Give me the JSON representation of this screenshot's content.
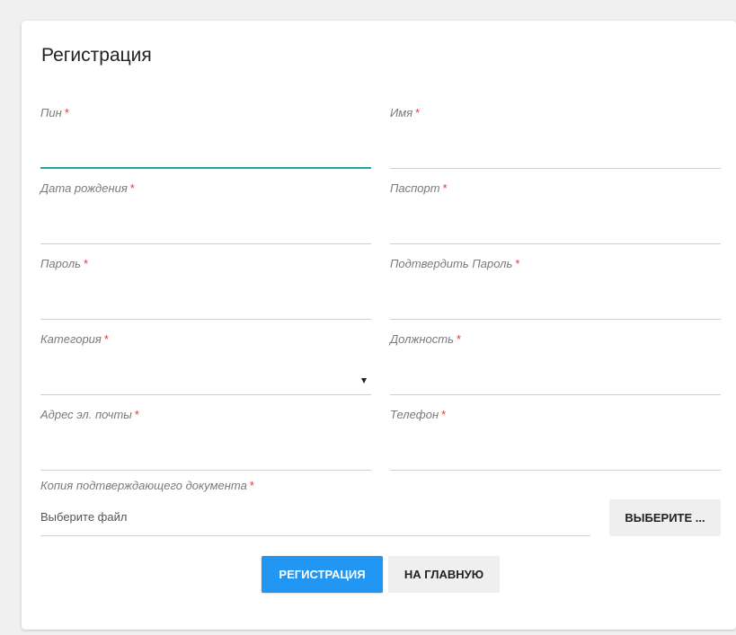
{
  "form": {
    "title": "Регистрация",
    "required_mark": "*",
    "fields": {
      "pin": {
        "label": "Пин",
        "value": ""
      },
      "name": {
        "label": "Имя",
        "value": ""
      },
      "birth_date": {
        "label": "Дата рождения",
        "value": ""
      },
      "passport": {
        "label": "Паспорт",
        "value": ""
      },
      "password": {
        "label": "Пароль",
        "value": ""
      },
      "confirm_password": {
        "label": "Подтвердить Пароль",
        "value": ""
      },
      "category": {
        "label": "Категория",
        "value": ""
      },
      "position": {
        "label": "Должность",
        "value": ""
      },
      "email": {
        "label": "Адрес эл. почты",
        "value": ""
      },
      "phone": {
        "label": "Телефон",
        "value": ""
      }
    },
    "file": {
      "label": "Копия подтверждающего документа",
      "placeholder": "Выберите файл",
      "button_label": "ВЫБЕРИТЕ ..."
    },
    "buttons": {
      "register": "РЕГИСТРАЦИЯ",
      "home": "НА ГЛАВНУЮ"
    }
  },
  "colors": {
    "page_background": "#f0f0f0",
    "card_background": "#ffffff",
    "focus_underline": "#26a69a",
    "required_mark": "#e53935",
    "primary_button": "#2196f3",
    "secondary_button": "#efefef"
  }
}
